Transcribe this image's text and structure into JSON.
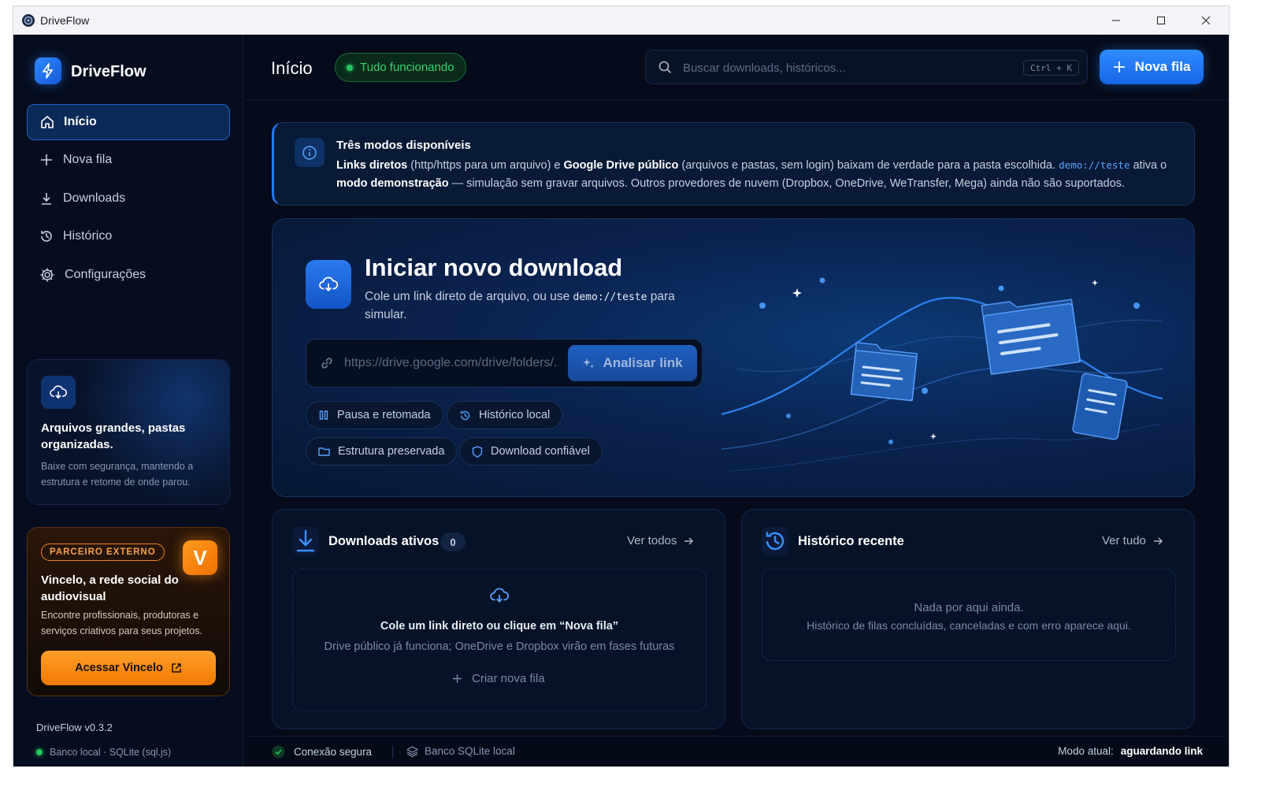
{
  "window": {
    "title": "DriveFlow"
  },
  "sidebar": {
    "brand": "DriveFlow",
    "nav": [
      {
        "label": "Início",
        "icon": "home-icon",
        "active": true
      },
      {
        "label": "Nova fila",
        "icon": "plus-icon"
      },
      {
        "label": "Downloads",
        "icon": "download-icon"
      },
      {
        "label": "Histórico",
        "icon": "history-icon"
      },
      {
        "label": "Configurações",
        "icon": "gear-icon"
      }
    ],
    "promo": {
      "title": "Arquivos grandes, pastas organizadas.",
      "desc": "Baixe com segurança, mantendo a estrutura e retome de onde parou."
    },
    "partner": {
      "badge": "PARCEIRO EXTERNO",
      "logo_letter": "V",
      "title": "Vincelo, a rede social do audiovisual",
      "desc": "Encontre profissionais, produtoras e serviços criativos para seus projetos.",
      "button": "Acessar Vincelo"
    },
    "version": "DriveFlow v0.3.2",
    "db_status": "Banco local · SQLite (sql.js)"
  },
  "header": {
    "title": "Início",
    "status": "Tudo funcionando",
    "search_placeholder": "Buscar downloads, históricos...",
    "shortcut": "Ctrl + K",
    "new_queue_button": "Nova fila"
  },
  "info_banner": {
    "title": "Três modos disponíveis",
    "p1_bold": "Links diretos",
    "p1": " (http/https para um arquivo) e ",
    "p2_bold": "Google Drive público",
    "p2": " (arquivos e pastas, sem login) baixam de verdade para a pasta escolhida. ",
    "code": "demo://teste",
    "p3": " ativa o ",
    "p4_bold": "modo demonstração",
    "p4": " — simulação sem gravar arquivos. Outros provedores de nuvem (Dropbox, OneDrive, WeTransfer, Mega) ainda não são suportados."
  },
  "hero": {
    "title": "Iniciar novo download",
    "desc_before": "Cole um link direto de arquivo, ou use ",
    "desc_code": "demo://teste",
    "desc_after": " para simular.",
    "url_placeholder": "https://drive.google.com/drive/folders/...",
    "analyze_button": "Analisar link",
    "chips": [
      "Pausa e retomada",
      "Histórico local",
      "Estrutura preservada",
      "Download confiável"
    ]
  },
  "active_downloads": {
    "title": "Downloads ativos",
    "count": "0",
    "see_all": "Ver todos",
    "empty_title": "Cole um link direto ou clique em “Nova fila”",
    "empty_desc": "Drive público já funciona; OneDrive e Dropbox virão em fases futuras",
    "create_button": "Criar nova fila"
  },
  "recent_history": {
    "title": "Histórico recente",
    "see_all": "Ver tudo",
    "empty_title": "Nada por aqui ainda.",
    "empty_desc": "Histórico de filas concluídas, canceladas e com erro aparece aqui."
  },
  "footer": {
    "secure": "Conexão segura",
    "db": "Banco SQLite local",
    "mode_label": "Modo atual:",
    "mode_value": "aguardando link"
  },
  "colors": {
    "accent": "#2f8bff",
    "success": "#22c55e",
    "partner": "#f28a1c",
    "background": "#050b1a"
  }
}
